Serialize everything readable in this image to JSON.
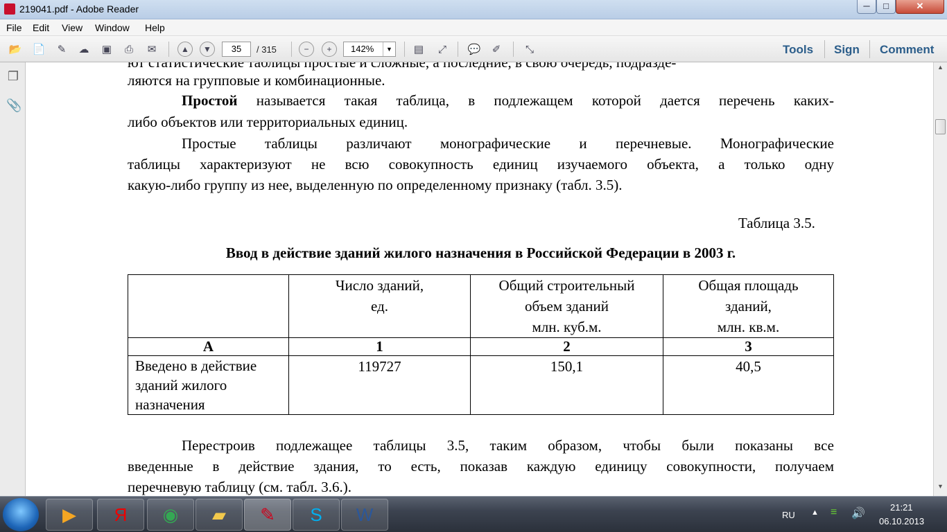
{
  "window": {
    "title": "219041.pdf - Adobe Reader",
    "minimize": "─",
    "maximize": "□",
    "close": "✕"
  },
  "menu": [
    "File",
    "Edit",
    "View",
    "Window",
    "Help"
  ],
  "toolbar": {
    "page_current": "35",
    "page_total": "/ 315",
    "zoom": "142%",
    "links": {
      "tools": "Tools",
      "sign": "Sign",
      "comment": "Comment"
    }
  },
  "document": {
    "lines": {
      "l0": "ют статистические таблицы простые и сложные, а последние, в свою очередь, подразде-",
      "l1": "ляются на групповые и комбинационные.",
      "l2_bold": "Простой",
      "l2_rest": " называется такая таблица, в подлежащем которой дается перечень каких-",
      "l3": "либо объектов или территориальных единиц.",
      "l4": "Простые таблицы различают монографические и перечневые. Монографические",
      "l5": "таблицы характеризуют не всю совокупность единиц изучаемого объекта, а только одну",
      "l6": "какую-либо группу из нее, выделенную по определенному признаку (табл. 3.5).",
      "table_label": "Таблица 3.5.",
      "table_title": "Ввод в действие зданий жилого назначения в Российской Федерации в 2003 г.",
      "p1": "Перестроив подлежащее таблицы 3.5, таким образом, чтобы были показаны все",
      "p2": "введенные в действие здания, то есть, показав каждую единицу совокупности, получаем",
      "p3": "перечневую таблицу (см. табл. 3.6.)."
    },
    "table": {
      "headers": [
        "",
        "Число зданий,\nед.",
        "Общий строительный\nобъем зданий\nмлн. куб.м.",
        "Общая площадь\nзданий,\nмлн. кв.м."
      ],
      "numbering": [
        "А",
        "1",
        "2",
        "3"
      ],
      "row": [
        "Введено в действие\nзданий жилого\nназначения",
        "119727",
        "150,1",
        "40,5"
      ]
    }
  },
  "taskbar": {
    "lang": "RU",
    "time": "21:21",
    "date": "06.10.2013"
  }
}
